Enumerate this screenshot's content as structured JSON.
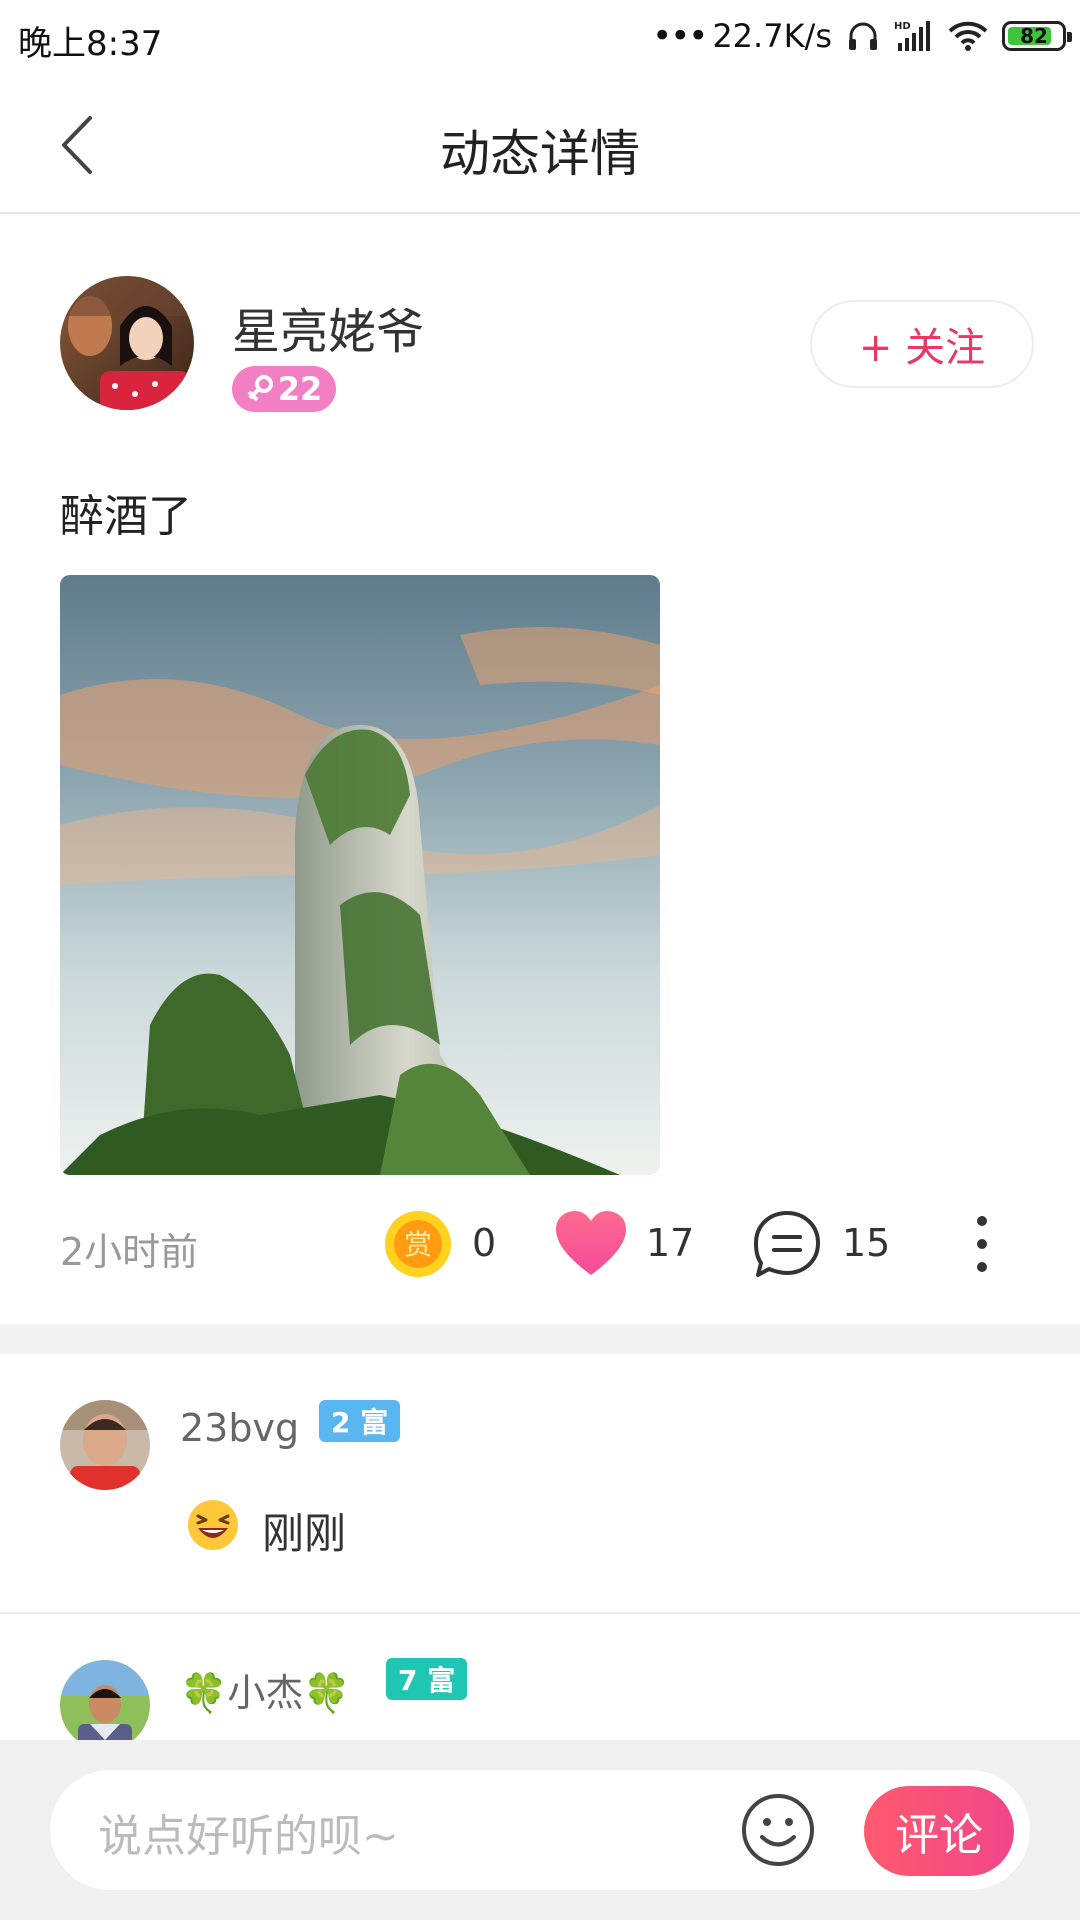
{
  "status_bar": {
    "time": "晚上8:37",
    "net_speed": "22.7K/s",
    "battery": "82",
    "battery_level": 0.82
  },
  "header": {
    "title": "动态详情"
  },
  "post": {
    "username": "星亮姥爷",
    "age": "22",
    "follow_label": "+ 关注",
    "text": "醉酒了",
    "time": "2小时前",
    "reward_icon_text": "赏",
    "reward_count": "0",
    "like_count": "17",
    "comment_count": "15"
  },
  "comments": [
    {
      "name": "23bvg",
      "badge": "2 富",
      "badge_color": "#5ab6f0",
      "text": "刚刚"
    },
    {
      "name": "🍀小杰🍀",
      "badge": "7 富",
      "badge_color": "#1fc6b3"
    }
  ],
  "composer": {
    "placeholder": "说点好听的呗~",
    "submit_label": "评论"
  },
  "colors": {
    "accent_pink": "#e83865",
    "gender_badge": "#f27ec4"
  }
}
